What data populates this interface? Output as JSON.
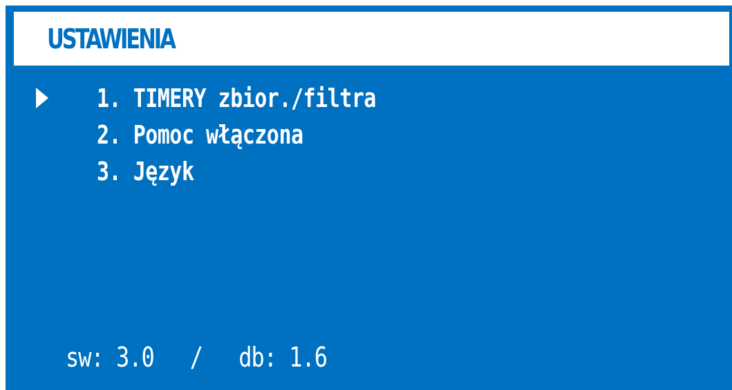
{
  "title": "USTAWIENIA",
  "menu": [
    {
      "label": "1. TIMERY zbior./filtra",
      "selected": true
    },
    {
      "label": "2. Pomoc włączona",
      "selected": false
    },
    {
      "label": "3. Język",
      "selected": false
    }
  ],
  "footer": {
    "software": "sw: 3.0",
    "separator": "/",
    "board": "db: 1.6"
  }
}
